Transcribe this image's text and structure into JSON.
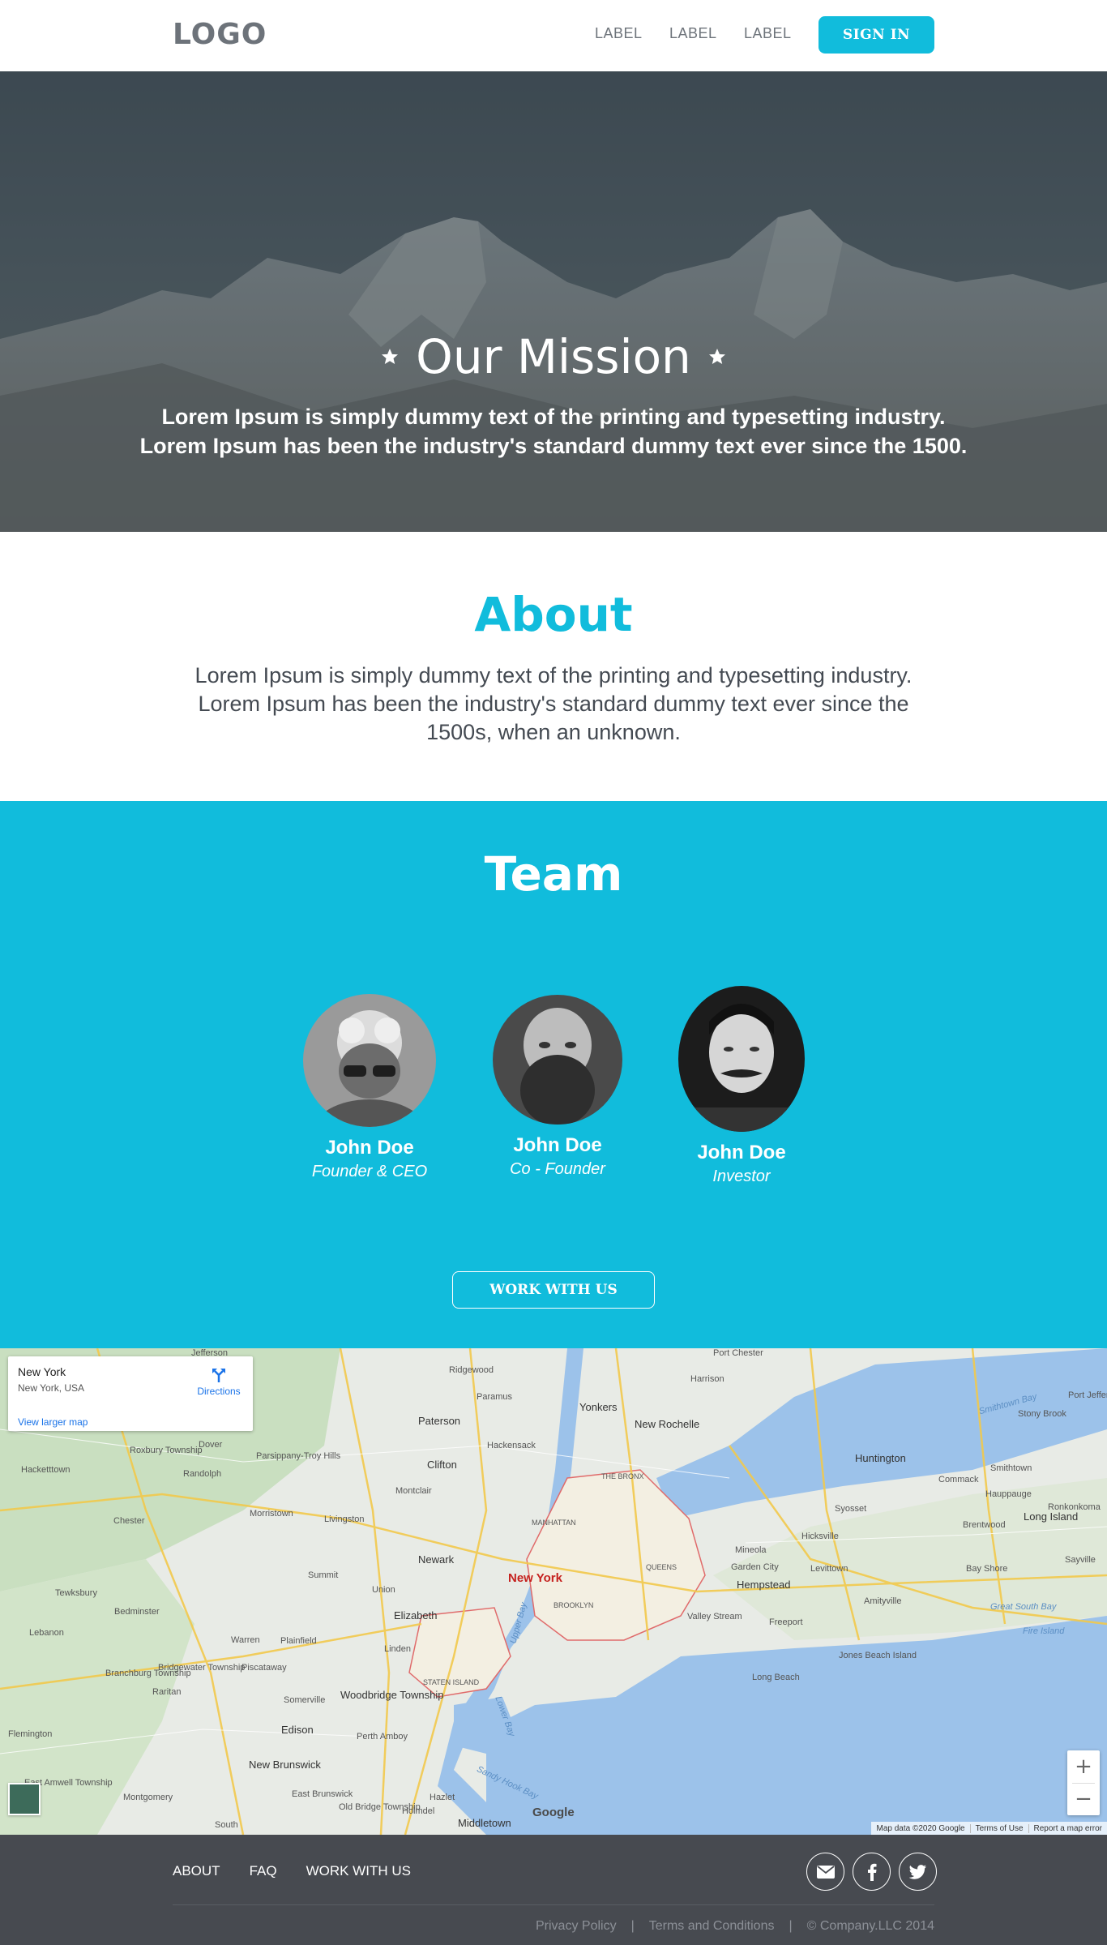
{
  "header": {
    "logo": "LOGO",
    "nav": [
      "LABEL",
      "LABEL",
      "LABEL"
    ],
    "signin_label": "SIGN IN"
  },
  "hero": {
    "title": "Our Mission",
    "text_line1": "Lorem Ipsum is simply dummy text of the printing and typesetting industry.",
    "text_line2": "Lorem Ipsum has been the industry's standard dummy text ever since the 1500."
  },
  "about": {
    "title": "About",
    "text": "Lorem Ipsum is simply dummy text of the printing and typesetting industry. Lorem Ipsum has been the industry's standard dummy text ever since the 1500s, when an unknown."
  },
  "team": {
    "title": "Team",
    "members": [
      {
        "name": "John Doe",
        "role": "Founder & CEO"
      },
      {
        "name": "John Doe",
        "role": "Co - Founder"
      },
      {
        "name": "John Doe",
        "role": "Investor"
      }
    ],
    "cta_label": "WORK WITH US"
  },
  "map": {
    "place_title": "New York",
    "place_sub": "New York, USA",
    "directions_label": "Directions",
    "larger_map_label": "View larger map",
    "zoom_in": "+",
    "zoom_out": "−",
    "google_label": "Google",
    "attribution": [
      "Map data ©2020 Google",
      "Terms of Use",
      "Report a map error"
    ],
    "labels": {
      "ny": "New York",
      "yonkers": "Yonkers",
      "new_rochelle": "New Rochelle",
      "paterson": "Paterson",
      "clifton": "Clifton",
      "newark": "Newark",
      "elizabeth": "Elizabeth",
      "hempstead": "Hempstead",
      "huntington": "Huntington",
      "long_beach": "Long Beach",
      "edison": "Edison",
      "new_brunswick": "New Brunswick",
      "woodbridge": "Woodbridge Township",
      "brooklyn": "BROOKLYN",
      "manhattan": "MANHATTAN",
      "queens": "QUEENS",
      "the_bronx": "THE BRONX",
      "staten_island": "STATEN ISLAND",
      "jones_beach": "Jones Beach Island",
      "long_island": "Long Island",
      "fire_island": "Fire Island",
      "great_south_bay": "Great South Bay",
      "middletown": "Middletown",
      "hackensack": "Hackensack",
      "morristown": "Morristown",
      "freeport": "Freeport",
      "harrison": "Harrison",
      "ridgewood": "Ridgewood",
      "montclair": "Montclair",
      "union": "Union",
      "plainfield": "Plainfield",
      "perth_amboy": "Perth Amboy",
      "hicksville": "Hicksville",
      "levittown": "Levittown",
      "smithtown": "Smithtown",
      "stony_brook": "Stony Brook",
      "brentwood": "Brentwood",
      "bay_shore": "Bay Shore",
      "sayville": "Sayville",
      "port_chester": "Port Chester",
      "jefferson": "Jefferson",
      "dover": "Dover",
      "randolph": "Randolph",
      "chester": "Chester",
      "summit": "Summit",
      "livingston": "Livingston",
      "linden": "Linden",
      "bedminster": "Bedminster",
      "somerville": "Somerville",
      "raritan": "Raritan",
      "piscataway": "Piscataway",
      "hazlet": "Hazlet",
      "sandy_hook_bay": "Sandy Hook Bay",
      "lower_bay": "Lower Bay",
      "upper_bay": "Upper Bay",
      "smithtown_bay": "Smithtown Bay",
      "mineola": "Mineola",
      "garden_city": "Garden City",
      "valley_stream": "Valley Stream",
      "amityville": "Amityville",
      "commack": "Commack",
      "hauppauge": "Hauppauge",
      "ronkonkoma": "Ronkonkoma",
      "paramus": "Paramus",
      "port_jefferson": "Port Jeffers",
      "hackettstown": "Hacketttown",
      "parsippany": "Parsippany-Troy Hills",
      "warren": "Warren",
      "east_brunswick": "East Brunswick",
      "old_bridge": "Old Bridge Township",
      "holmdel": "Holmdel",
      "montgomery": "Montgomery",
      "flemington": "Flemington",
      "tewksbury": "Tewksbury",
      "lebanon": "Lebanon",
      "branchburg": "Branchburg Township",
      "bridgewater": "Bridgewater Township",
      "roxbury": "Roxbury Township",
      "east_amwell": "East Amwell Township",
      "south": "South",
      "syosset": "Syosset"
    }
  },
  "footer": {
    "links": [
      "ABOUT",
      "FAQ",
      "WORK WITH US"
    ],
    "privacy": "Privacy Policy",
    "terms": "Terms and Conditions",
    "copyright": "© Company.LLC 2014"
  },
  "colors": {
    "accent": "#11bcdc",
    "footer_bg": "#474a50",
    "text": "#444a52"
  },
  "icons": {
    "social": [
      "envelope-icon",
      "facebook-icon",
      "twitter-icon"
    ]
  }
}
